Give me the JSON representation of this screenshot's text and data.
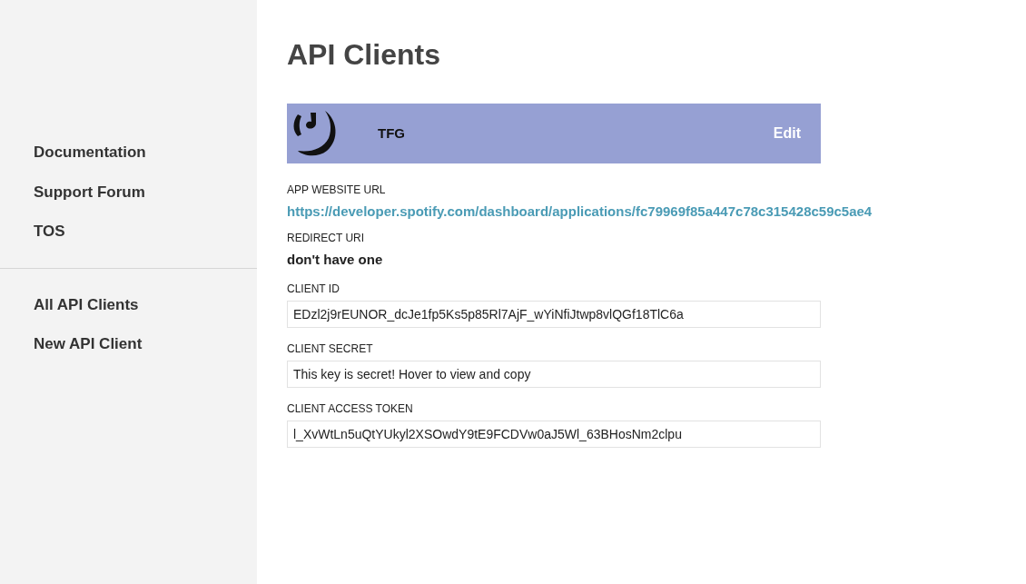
{
  "sidebar": {
    "groups": [
      [
        "Documentation",
        "Support Forum",
        "TOS"
      ],
      [
        "All API Clients",
        "New API Client"
      ]
    ]
  },
  "page_title": "API Clients",
  "app": {
    "name": "TFG",
    "edit": "Edit"
  },
  "fields": [
    {
      "kind": "link",
      "label": "APP WEBSITE URL",
      "value": "https://developer.spotify.com/dashboard/applications/fc79969f85a447c78c315428c59c5ae4"
    },
    {
      "kind": "text",
      "label": "REDIRECT URI",
      "value": "don't have one"
    },
    {
      "kind": "input",
      "label": "CLIENT ID",
      "value": "EDzl2j9rEUNOR_dcJe1fp5Ks5p85Rl7AjF_wYiNfiJtwp8vlQGf18TlC6a"
    },
    {
      "kind": "input",
      "label": "CLIENT SECRET",
      "value": "This key is secret! Hover to view and copy"
    },
    {
      "kind": "input",
      "label": "CLIENT ACCESS TOKEN",
      "value": "l_XvWtLn5uQtYUkyl2XSOwdY9tE9FCDVw0aJ5Wl_63BHosNm2clpu"
    }
  ]
}
